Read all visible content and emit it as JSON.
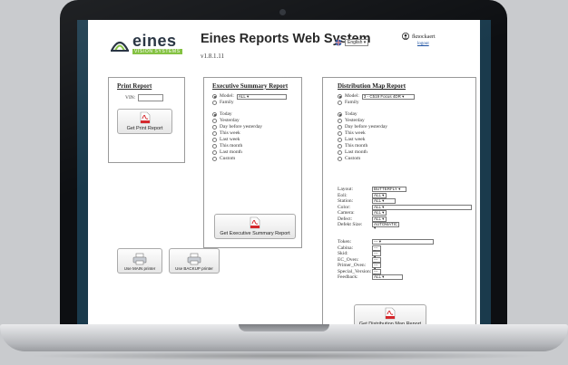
{
  "header": {
    "logo_word": "eines",
    "logo_sub": "VISION SYSTEMS",
    "title": "Eines Reports Web System",
    "version": "v1.8.1.11",
    "language": "English",
    "username": "fknockaert",
    "logout_label": "logout"
  },
  "print_report": {
    "title": "Print Report",
    "vin_label": "VIN:",
    "vin_value": "",
    "button_label": "Get Print Report"
  },
  "executive": {
    "title": "Executive Summary Report",
    "model_label": "Model:",
    "model_value": "ALL",
    "family_label": "Family",
    "periods": [
      "Today",
      "Yesterday",
      "Day before yesterday",
      "This week",
      "Last week",
      "This month",
      "Last month",
      "Custom"
    ],
    "selected_period": "Today",
    "button_label": "Get Executive Summary Report"
  },
  "printers": {
    "main_label": "Use MAIN printer",
    "backup_label": "Use BACKUP printer"
  },
  "distribution": {
    "title": "Distribution Map Report",
    "model_label": "Model:",
    "model_value": "3 - C519 Focus 4DR",
    "family_label": "Family",
    "periods": [
      "Today",
      "Yesterday",
      "Day before yesterday",
      "This week",
      "Last week",
      "This month",
      "Last month",
      "Custom"
    ],
    "selected_period": "Today",
    "fields": [
      {
        "label": "Layout:",
        "value": "BUTTERFLY"
      },
      {
        "label": "Eoli:",
        "value": "ALL"
      },
      {
        "label": "Station:",
        "value": "ALL"
      },
      {
        "label": "Color:",
        "value": "ALL"
      },
      {
        "label": "Camera:",
        "value": "ALL"
      },
      {
        "label": "Defect:",
        "value": "ALL"
      },
      {
        "label": "Defekt Size:",
        "value": "AUTOMATIC"
      }
    ],
    "fields2": [
      {
        "label": "Token:",
        "value": "---"
      },
      {
        "label": "Cabina:",
        "value": "---"
      },
      {
        "label": "Skid:",
        "value": "---"
      },
      {
        "label": "EC_Oven:",
        "value": "---"
      },
      {
        "label": "Primer_Oven:",
        "value": "---"
      },
      {
        "label": "Special_Version:",
        "value": "---"
      },
      {
        "label": "Feedback:",
        "value": "ALL"
      }
    ],
    "button_label": "Get Distribution Map Report"
  },
  "colors": {
    "accent_green": "#7fbf3a",
    "pdf_red": "#d4262b",
    "screen_frame": "#1a3a4c"
  }
}
